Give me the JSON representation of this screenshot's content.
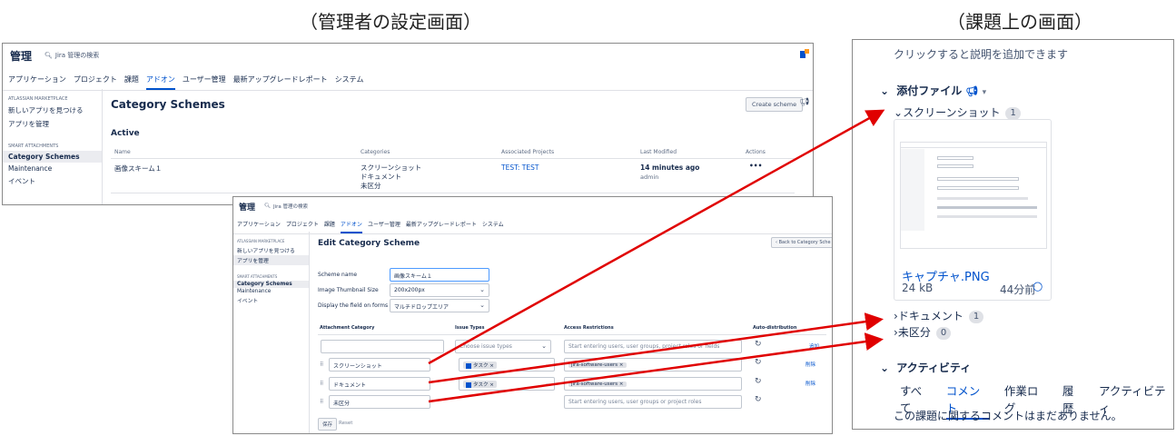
{
  "captions": {
    "left": "（管理者の設定画面）",
    "right": "（課題上の画面）"
  },
  "admin": {
    "title": "管理",
    "search": "Jira 管理の検索",
    "nav": [
      "アプリケーション",
      "プロジェクト",
      "課題",
      "アドオン",
      "ユーザー管理",
      "最新アップグレードレポート",
      "システム"
    ],
    "active_nav": "アドオン",
    "sidebar": {
      "group1": "ATLASSIAN MARKETPLACE",
      "item1": "新しいアプリを見つける",
      "item2": "アプリを管理",
      "group2": "SMART ATTACHMENTS",
      "item3": "Category Schemes",
      "item4": "Maintenance",
      "item5": "イベント"
    }
  },
  "list_page": {
    "title": "Category Schemes",
    "create_button": "Create scheme",
    "section": "Active",
    "columns": [
      "Name",
      "Categories",
      "Associated Projects",
      "Last Modified",
      "Actions"
    ],
    "row": {
      "name": "画像スキーム１",
      "categories": [
        "スクリーンショット",
        "ドキュメント",
        "未区分"
      ],
      "project": "TEST: TEST",
      "modified": "14 minutes ago",
      "modified_by": "admin",
      "actions": "•••"
    }
  },
  "edit_page": {
    "title": "Edit Category Scheme",
    "back_button": "Back to Category Sche",
    "fields": {
      "scheme_name_label": "Scheme name",
      "scheme_name_value": "画像スキーム１",
      "thumb_label": "Image Thumbnail Size",
      "thumb_value": "200x200px",
      "display_label": "Display the field on forms as",
      "display_value": "マルチドロップエリア"
    },
    "columns": [
      "Attachment Category",
      "Issue Types",
      "Access Restrictions",
      "Auto-distribution"
    ],
    "new_row": {
      "issue_placeholder": "Choose issue types",
      "access_placeholder": "Start entering users, user groups, project roles or fields",
      "action": "追加"
    },
    "rows": [
      {
        "category": "スクリーンショット",
        "issue_tag": "タスク",
        "access_tag": "jira-software-users",
        "action": "削除"
      },
      {
        "category": "ドキュメント",
        "issue_tag": "タスク",
        "access_tag": "jira-software-users",
        "action": "削除"
      },
      {
        "category": "未区分",
        "access_placeholder": "Start entering users, user groups or project roles"
      }
    ],
    "save": "保存",
    "reset": "Reset"
  },
  "issue_panel": {
    "description_hint": "クリックすると説明を追加できます",
    "attachments_title": "添付ファイル",
    "categories": [
      {
        "name": "スクリーンショット",
        "count": "1"
      },
      {
        "name": "ドキュメント",
        "count": "1"
      },
      {
        "name": "未区分",
        "count": "0"
      }
    ],
    "file": {
      "name": "キャプチャ.PNG",
      "size": "24 kB",
      "time": "44分前"
    },
    "activity_title": "アクティビティ",
    "tabs": [
      "すべて",
      "コメント",
      "作業ログ",
      "履歴",
      "アクティビティ"
    ],
    "active_tab": "コメント",
    "empty_comments": "この課題に関するコメントはまだありません。"
  },
  "colors": {
    "accent": "#0052cc",
    "arrow": "#e00000"
  }
}
